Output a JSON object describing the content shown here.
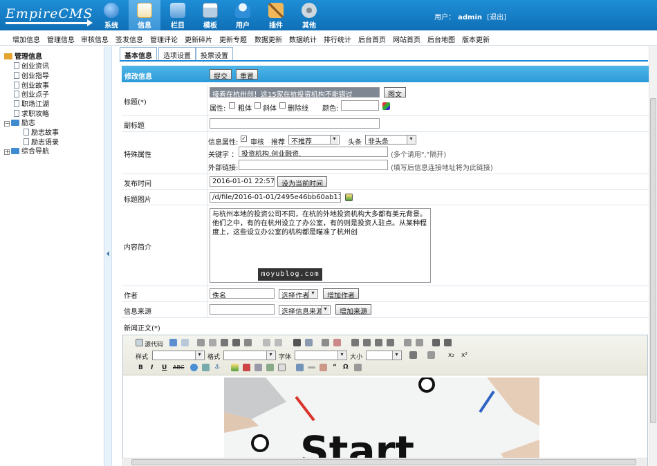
{
  "logo": "EmpireCMS",
  "topnav": [
    {
      "label": "系统",
      "icon": "globe-icon",
      "color": "#3f8fd2"
    },
    {
      "label": "信息",
      "icon": "document-pencil-icon",
      "color": "#f0c14b"
    },
    {
      "label": "栏目",
      "icon": "folder-icon",
      "color": "#6aa7dd"
    },
    {
      "label": "模板",
      "icon": "window-icon",
      "color": "#9fc2e0"
    },
    {
      "label": "用户",
      "icon": "user-icon",
      "color": "#e7f3fb"
    },
    {
      "label": "插件",
      "icon": "tools-icon",
      "color": "#e6a84a"
    },
    {
      "label": "其他",
      "icon": "gear-icon",
      "color": "#cfd8de"
    }
  ],
  "user": {
    "prefix": "用户：",
    "name": "admin",
    "logout": "[退出]"
  },
  "menu": [
    "增加信息",
    "管理信息",
    "审核信息",
    "签发信息",
    "管理评论",
    "更新碎片",
    "更新专题",
    "数据更新",
    "数据统计",
    "排行统计",
    "后台首页",
    "网站首页",
    "后台地图",
    "版本更新"
  ],
  "sidebar": {
    "root": "管理信息",
    "items": [
      "创业资讯",
      "创业指导",
      "创业故事",
      "创业点子",
      "职场江湖",
      "求职攻略"
    ],
    "group": "励志",
    "subitems": [
      "励志故事",
      "励志语录"
    ],
    "last": "综合导航"
  },
  "tabs": [
    "基本信息",
    "选项设置",
    "投票设置"
  ],
  "form": {
    "header": "修改信息",
    "submit": "提交",
    "reset": "重置",
    "title_label": "标题(*)",
    "title_value": "接着在杭州创！这15家在杭投资机构不能错过",
    "title_image_btn": "图文",
    "attr_label": "属性:",
    "bold": "粗体",
    "italic": "斜体",
    "strike": "删除线",
    "color_label": "颜色:",
    "subtitle_label": "副标题",
    "special_label": "特殊属性",
    "info_attr_label": "信息属性:",
    "audit": "审核",
    "recommend_label": "推荐",
    "recommend_value": "不推荐",
    "headline_label": "头条",
    "headline_value": "非头条",
    "keywords_label": "关键字 ：",
    "keywords_value": "投资机构,创业融资,",
    "keywords_hint": "(多个请用\",\"隔开)",
    "link_label": "外部链接:",
    "link_hint": "(填写后信息连接地址将为此链接)",
    "time_label": "发布时间",
    "time_value": "2016-01-01 22:57:34",
    "time_btn": "设为当前时间",
    "image_label": "标题图片",
    "image_value": "/d/file/2016-01-01/2495e46bb60ab13f9e3fd",
    "summary_label": "内容简介",
    "summary_value": "与杭州本地的投资公司不同，在杭的外地投资机构大多都有美元背景。他们之中，有的在杭州设立了办公室，有的则是投资人驻点。从某种程度上，这些设立办公室的机构都是瞄准了杭州创",
    "author_label": "作者",
    "author_value": "佚名",
    "author_select": "选择作者",
    "author_add": "增加作者",
    "source_label": "信息来源",
    "source_select": "选择信息来源",
    "source_add": "增加来源",
    "body_label": "新闻正文(*)"
  },
  "editor": {
    "source_btn": "源代码",
    "style_label": "样式",
    "format_label": "格式",
    "font_label": "字体",
    "size_label": "大小",
    "image_text": "Start"
  },
  "watermark": "moyublog.com"
}
